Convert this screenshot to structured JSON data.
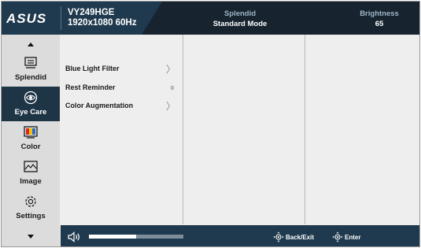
{
  "header": {
    "brand": "ASUS",
    "model": "VY249HGE",
    "resolution": "1920x1080 60Hz",
    "splendid_label": "Splendid",
    "splendid_value": "Standard Mode",
    "brightness_label": "Brightness",
    "brightness_value": "65"
  },
  "sidebar": {
    "items": [
      {
        "label": "Splendid",
        "icon": "splendid-icon"
      },
      {
        "label": "Eye Care",
        "icon": "eye-care-icon",
        "active": true
      },
      {
        "label": "Color",
        "icon": "color-icon"
      },
      {
        "label": "Image",
        "icon": "image-icon"
      },
      {
        "label": "Settings",
        "icon": "settings-icon"
      }
    ]
  },
  "menu": {
    "items": [
      {
        "label": "Blue Light Filter",
        "has_submenu": true
      },
      {
        "label": "Rest Reminder",
        "value": "0"
      },
      {
        "label": "Color Augmentation",
        "has_submenu": true
      }
    ]
  },
  "footer": {
    "volume_level": 0.5,
    "back_label": "Back/Exit",
    "enter_label": "Enter"
  },
  "colors": {
    "header_bg": "#1f3a4e",
    "active_bg": "#1e3546",
    "panel_bg": "#eeeeee",
    "sidebar_bg": "#dcdcdc"
  }
}
